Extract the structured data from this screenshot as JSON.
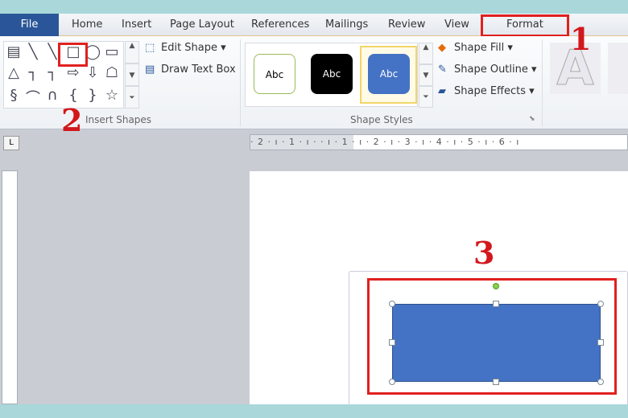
{
  "tabs": {
    "file": "File",
    "home": "Home",
    "insert": "Insert",
    "page_layout": "Page Layout",
    "references": "References",
    "mailings": "Mailings",
    "review": "Review",
    "view": "View",
    "format": "Format"
  },
  "insert_shapes": {
    "group_label": "Insert Shapes",
    "edit_shape": "Edit Shape ▾",
    "draw_text_box": "Draw Text Box"
  },
  "shape_styles": {
    "group_label": "Shape Styles",
    "styles": [
      "Abc",
      "Abc",
      "Abc"
    ],
    "shape_fill": "Shape Fill ▾",
    "shape_outline": "Shape Outline ▾",
    "shape_effects": "Shape Effects ▾"
  },
  "wordart": {
    "sample": "A"
  },
  "ruler": {
    "text": "· 2 · ı · 1 · ı ·   · ı · 1 · ı · 2 · ı · 3 · ı · 4 · ı · 5 · ı · 6 · ı"
  },
  "annotations": {
    "step1": "1",
    "step2": "2",
    "step3": "3"
  },
  "colors": {
    "file_tab": "#2a5699",
    "shape_fill": "#4472c4",
    "highlight": "#e0201f"
  }
}
